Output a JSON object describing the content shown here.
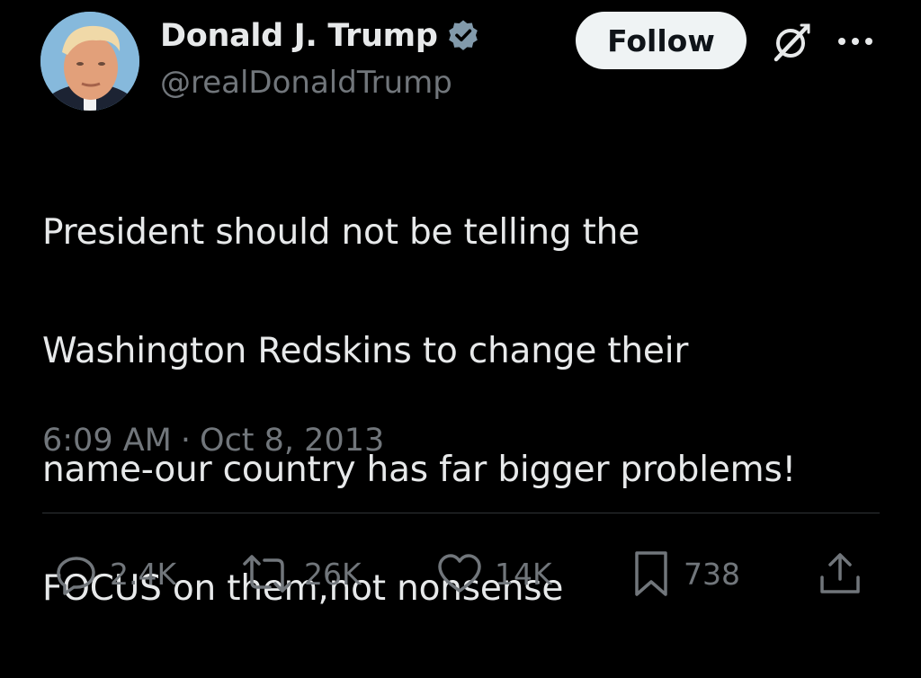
{
  "author": {
    "display_name": "Donald J. Trump",
    "handle": "@realDonaldTrump",
    "verified": true,
    "avatar_icon": "profile-photo"
  },
  "header": {
    "follow_label": "Follow",
    "grok_icon": "grok-icon",
    "more_icon": "more-dots-icon"
  },
  "tweet": {
    "lines": [
      "President should not be telling the",
      "Washington Redskins to change their",
      "name-our country has far bigger problems!",
      "FOCUS on them,not nonsense"
    ],
    "time": "6:09 AM",
    "separator": "·",
    "date": "Oct 8, 2013"
  },
  "actions": {
    "reply_count": "2.4K",
    "retweet_count": "26K",
    "like_count": "14K",
    "bookmark_count": "738"
  },
  "colors": {
    "background": "#000000",
    "text_primary": "#e7e9ea",
    "text_secondary": "#71767b",
    "verified_badge": "#829aab",
    "follow_button_bg": "#eff3f4"
  }
}
